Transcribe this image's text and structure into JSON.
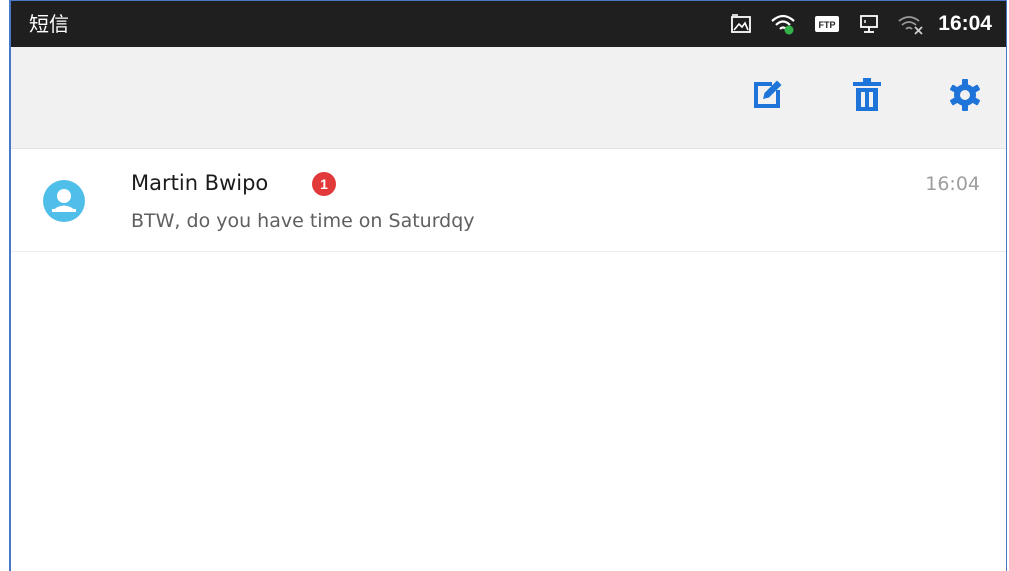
{
  "status_bar": {
    "title": "短信",
    "time": "16:04",
    "icons": [
      "gallery-icon",
      "wifi-ap-icon",
      "ftp-icon",
      "ethernet-icon",
      "wifi-off-icon"
    ]
  },
  "toolbar": {
    "actions": [
      "compose-icon",
      "trash-icon",
      "settings-icon"
    ],
    "accent_color": "#1e74d8"
  },
  "conversations": [
    {
      "name": "Martin Bwipo",
      "unread": "1",
      "preview": "BTW, do you have time on Saturdqy",
      "time": "16:04",
      "avatar_color": "#4fbfea",
      "badge_color": "#e23a3a"
    }
  ]
}
